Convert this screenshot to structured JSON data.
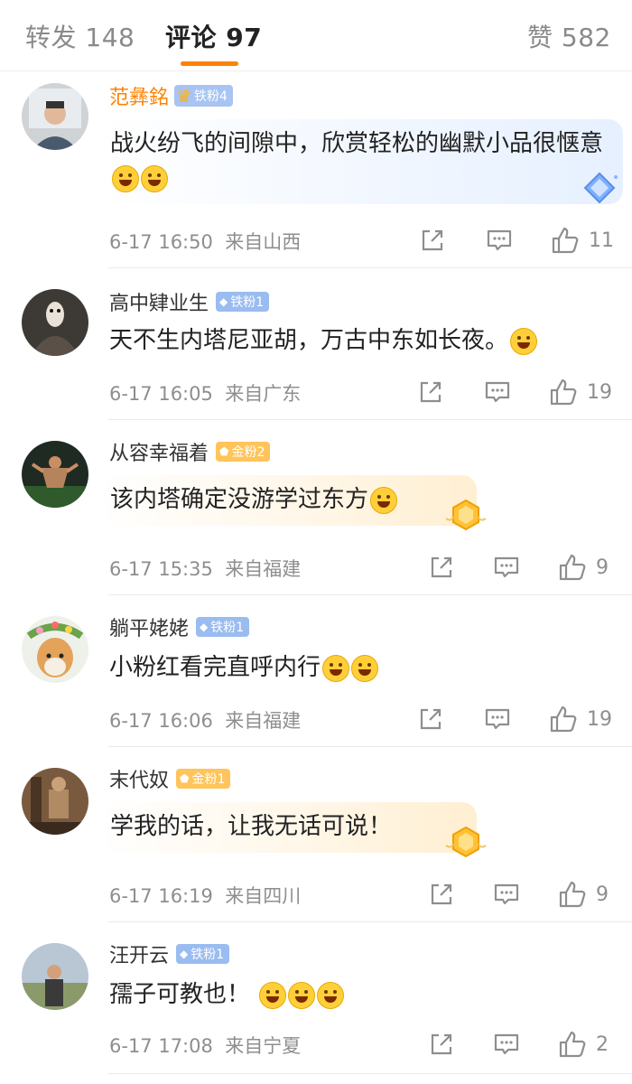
{
  "tabs": {
    "repost": "转发 148",
    "comments": "评论 97",
    "likes": "赞 582"
  },
  "comments": [
    {
      "name": "范彝銘",
      "badge": "铁粉4",
      "text": "战火纷飞的间隙中，欣赏轻松的幽默小品很惬意",
      "time": "6-17 16:50",
      "location": "来自山西",
      "likes": "11"
    },
    {
      "name": "高中肄业生",
      "badge": "铁粉1",
      "text": "天不生内塔尼亚胡，万古中东如长夜。",
      "time": "6-17 16:05",
      "location": "来自广东",
      "likes": "19"
    },
    {
      "name": "从容幸福着",
      "badge": "金粉2",
      "text": "该内塔确定没游学过东方",
      "time": "6-17 15:35",
      "location": "来自福建",
      "likes": "9"
    },
    {
      "name": "躺平姥姥",
      "badge": "铁粉1",
      "text": "小粉红看完直呼内行",
      "time": "6-17 16:06",
      "location": "来自福建",
      "likes": "19"
    },
    {
      "name": "末代奴",
      "badge": "金粉1",
      "text": "学我的话，让我无话可说！",
      "time": "6-17 16:19",
      "location": "来自四川",
      "likes": "9"
    },
    {
      "name": "汪开云",
      "badge": "铁粉1",
      "text": "孺子可教也！",
      "time": "6-17 17:08",
      "location": "来自宁夏",
      "likes": "2"
    }
  ],
  "icons": {
    "share": "share-icon",
    "comment": "comment-icon",
    "like": "thumbs-up-icon"
  },
  "colors": {
    "accent": "#ff8200",
    "username_highlight": "#ff8200",
    "iron_badge": "#9bbcf0",
    "gold_badge": "#ffc45a"
  }
}
